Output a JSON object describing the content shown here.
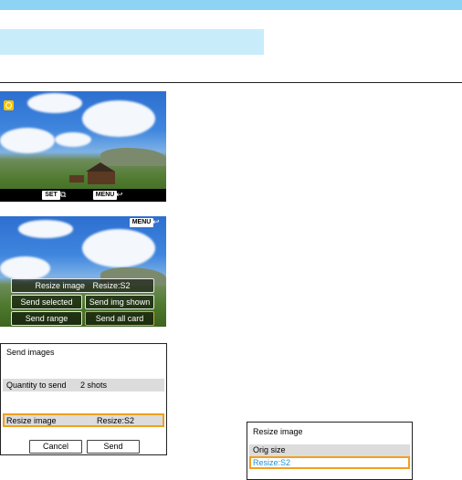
{
  "screen1": {
    "set_label": "SET",
    "set_icon": "playback-icon",
    "menu_label": "MENU",
    "back_icon": "return-arrow-icon",
    "globe_icon": "globe-icon"
  },
  "screen2": {
    "menu_label": "MENU",
    "back_icon": "return-arrow-icon",
    "resize_label": "Resize image",
    "resize_value": "Resize:S2",
    "send_selected": "Send selected",
    "send_img_shown": "Send img shown",
    "send_range": "Send range",
    "send_all_card": "Send all card"
  },
  "screen3": {
    "title": "Send images",
    "quantity_label": "Quantity to send",
    "quantity_value": "2 shots",
    "resize_label": "Resize image",
    "resize_value": "Resize:S2",
    "cancel": "Cancel",
    "send": "Send"
  },
  "screen4": {
    "title": "Resize image",
    "option1": "Orig size",
    "option2": "Resize:S2"
  },
  "colors": {
    "header_bar": "#8dd3f4",
    "subheader_bar": "#c9ecfb",
    "selection": "#f0a020"
  }
}
